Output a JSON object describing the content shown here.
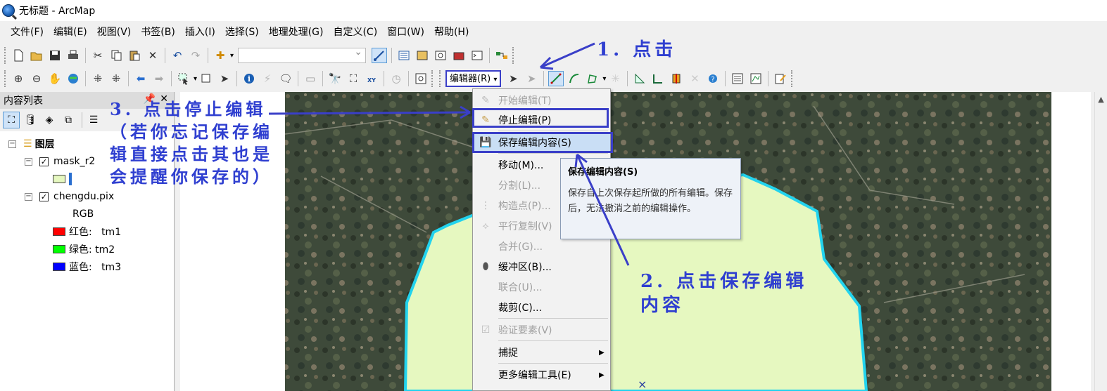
{
  "window": {
    "title": "无标题 - ArcMap"
  },
  "menubar": [
    "文件(F)",
    "编辑(E)",
    "视图(V)",
    "书签(B)",
    "插入(I)",
    "选择(S)",
    "地理处理(G)",
    "自定义(C)",
    "窗口(W)",
    "帮助(H)"
  ],
  "toolbar2": {
    "editor_label": "编辑器(R)"
  },
  "toc": {
    "title": "内容列表",
    "layers_root": "图层",
    "layer1": "mask_r2",
    "layer2": "chengdu.pix",
    "rgb_label": "RGB",
    "bands": [
      {
        "label": "红色:   tm1",
        "color": "#ff0000"
      },
      {
        "label": "绿色: tm2",
        "color": "#00ff00"
      },
      {
        "label": "蓝色:   tm3",
        "color": "#0000ff"
      }
    ]
  },
  "editor_menu": {
    "start": "开始编辑(T)",
    "stop": "停止编辑(P)",
    "save": "保存编辑内容(S)",
    "move": "移动(M)...",
    "split": "分割(L)...",
    "construct": "构造点(P)...",
    "parallel": "平行复制(V)",
    "merge": "合并(G)...",
    "buffer": "缓冲区(B)...",
    "union": "联合(U)...",
    "clip": "裁剪(C)...",
    "validate": "验证要素(V)",
    "snapping": "捕捉",
    "more_tools": "更多编辑工具(E)"
  },
  "tooltip": {
    "title": "保存编辑内容(S)",
    "body": "保存自上次保存起所做的所有编辑。保存后，无法撤消之前的编辑操作。"
  },
  "annotations": {
    "step1": "1. 点击",
    "step2": "2. 点击保存编辑内容",
    "step3": "3. 点击停止编辑（若你忘记保存编辑直接点击其也是会提醒你保存的）"
  },
  "colors": {
    "annotation": "#2f3fd0",
    "polygon_fill": "#e6f8c0",
    "polygon_outline": "#22d3ee",
    "highlight": "#c9def5"
  }
}
